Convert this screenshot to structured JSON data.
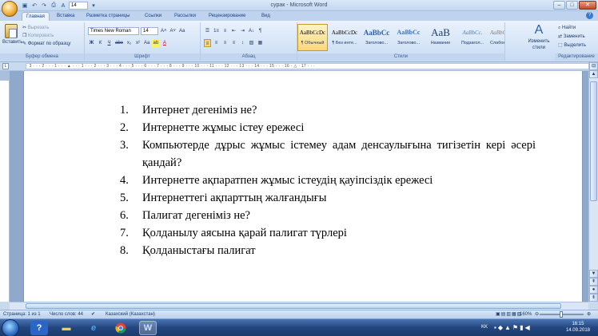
{
  "window": {
    "title": "сурак - Microsoft Word",
    "font_size_quick": "14",
    "minimize": "–",
    "maximize": "□",
    "close": "✕"
  },
  "tabs": [
    "Главная",
    "Вставка",
    "Разметка страницы",
    "Ссылки",
    "Рассылки",
    "Рецензирование",
    "Вид"
  ],
  "help_label": "?",
  "clipboard": {
    "paste": "Вставить",
    "cut": "Вырезать",
    "copy": "Копировать",
    "format_painter": "Формат по образцу",
    "group_label": "Буфер обмена"
  },
  "font": {
    "name": "Times New Roman",
    "size": "14",
    "grow": "A˄",
    "shrink": "A˅",
    "clear": "Aa",
    "bold": "Ж",
    "italic": "К",
    "underline": "Ч",
    "strike": "abe",
    "subscript": "x₂",
    "superscript": "x²",
    "change_case": "Aa",
    "highlight": "ab",
    "color": "A",
    "group_label": "Шрифт"
  },
  "paragraph": {
    "bullets": "☰",
    "numbering": "1≡",
    "multilevel": "≡",
    "decrease_indent": "⇤",
    "increase_indent": "⇥",
    "sort": "A↓",
    "show_marks": "¶",
    "align_left": "≡",
    "align_center": "≡",
    "align_right": "≡",
    "justify": "≡",
    "line_spacing": "↕",
    "shading": "▧",
    "borders": "▦",
    "group_label": "Абзац"
  },
  "styles": {
    "items": [
      {
        "preview": "AaBbCcDc",
        "name": "¶ Обычный"
      },
      {
        "preview": "AaBbCcDc",
        "name": "¶ Без инте..."
      },
      {
        "preview": "AaBbCс",
        "name": "Заголово..."
      },
      {
        "preview": "AaBbCc",
        "name": "Заголово..."
      },
      {
        "preview": "AaB",
        "name": "Название"
      },
      {
        "preview": "AaBbCc.",
        "name": "Подзагол..."
      },
      {
        "preview": "AaBbCcDc",
        "name": "Слабое в..."
      }
    ],
    "change_styles": "Изменить стили",
    "group_label": "Стили"
  },
  "editing": {
    "find": "Найти",
    "replace": "Заменить",
    "select": "Выделить",
    "group_label": "Редактирование"
  },
  "ruler_ticks": "· 3 · · · 2 · · · 1 · · · ▲ · · · 1 · · · 2 · · · 3 · · · 4 · · · 5 · · · 6 · · · 7 · · · 8 · · · 9 · · · 10 · · · 11 · · · 12 · · · 13 · · · 14 · · · 15 · · · 16 · △ · 17 · · ·",
  "document": {
    "items": [
      {
        "num": "1.",
        "text": "Интернет дегеніміз не?"
      },
      {
        "num": "2.",
        "text": "Интернетте жұмыс істеу ережесі"
      },
      {
        "num": "3.",
        "text": "Компьютерде дұрыс жұмыс істемеу адам денсаулығына тигізетін кері әсері қандай?"
      },
      {
        "num": "4.",
        "text": "Интернетте ақпаратпен жұмыс істеудің қауіпсіздік ережесі"
      },
      {
        "num": "5.",
        "text": "Интернеттегі ақпарттың жалғандығы"
      },
      {
        "num": "6.",
        "text": "Палигат дегеніміз не?"
      },
      {
        "num": "7.",
        "text": "Қолданылу аясына қарай палигат түрлері"
      },
      {
        "num": "8.",
        "text": "Қолданыстағы палигат"
      }
    ]
  },
  "statusbar": {
    "page": "Страница: 1 из 1",
    "words": "Число слов: 44",
    "language": "Казахский (Казахстан)",
    "zoom": "160%"
  },
  "taskbar": {
    "language": "KK",
    "time": "16:15",
    "date": "14.09.2018"
  }
}
